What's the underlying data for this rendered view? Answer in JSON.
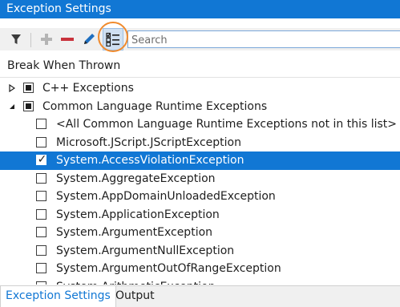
{
  "window": {
    "title": "Exception Settings"
  },
  "toolbar": {
    "buttons": [
      {
        "id": "filter",
        "icon": "filter-icon",
        "enabled": true
      },
      {
        "id": "add",
        "icon": "plus-icon",
        "enabled": false
      },
      {
        "id": "delete",
        "icon": "minus-icon",
        "enabled": true
      },
      {
        "id": "edit",
        "icon": "pencil-icon",
        "enabled": true
      },
      {
        "id": "checklist",
        "icon": "checklist-icon",
        "enabled": true,
        "highlighted": true
      }
    ],
    "search": {
      "placeholder": "Search",
      "value": ""
    }
  },
  "list": {
    "column_header": "Break When Thrown",
    "items": [
      {
        "label": "C++ Exceptions",
        "level": 0,
        "expander": "collapsed",
        "check": "partial"
      },
      {
        "label": "Common Language Runtime Exceptions",
        "level": 0,
        "expander": "expanded",
        "check": "partial"
      },
      {
        "label": "<All Common Language Runtime Exceptions not in this list>",
        "level": 1,
        "check": "unchecked"
      },
      {
        "label": "Microsoft.JScript.JScriptException",
        "level": 1,
        "check": "unchecked"
      },
      {
        "label": "System.AccessViolationException",
        "level": 1,
        "check": "checked",
        "selected": true
      },
      {
        "label": "System.AggregateException",
        "level": 1,
        "check": "unchecked"
      },
      {
        "label": "System.AppDomainUnloadedException",
        "level": 1,
        "check": "unchecked"
      },
      {
        "label": "System.ApplicationException",
        "level": 1,
        "check": "unchecked"
      },
      {
        "label": "System.ArgumentException",
        "level": 1,
        "check": "unchecked"
      },
      {
        "label": "System.ArgumentNullException",
        "level": 1,
        "check": "unchecked"
      },
      {
        "label": "System.ArgumentOutOfRangeException",
        "level": 1,
        "check": "unchecked"
      },
      {
        "label": "System.ArithmeticException",
        "level": 1,
        "check": "unchecked"
      }
    ]
  },
  "bottom_tabs": [
    {
      "label": "Exception Settings",
      "active": true
    },
    {
      "label": "Output",
      "active": false
    }
  ],
  "colors": {
    "accent": "#1177d4",
    "highlight_ring": "#f08a2c",
    "delete_red": "#c8323c"
  }
}
